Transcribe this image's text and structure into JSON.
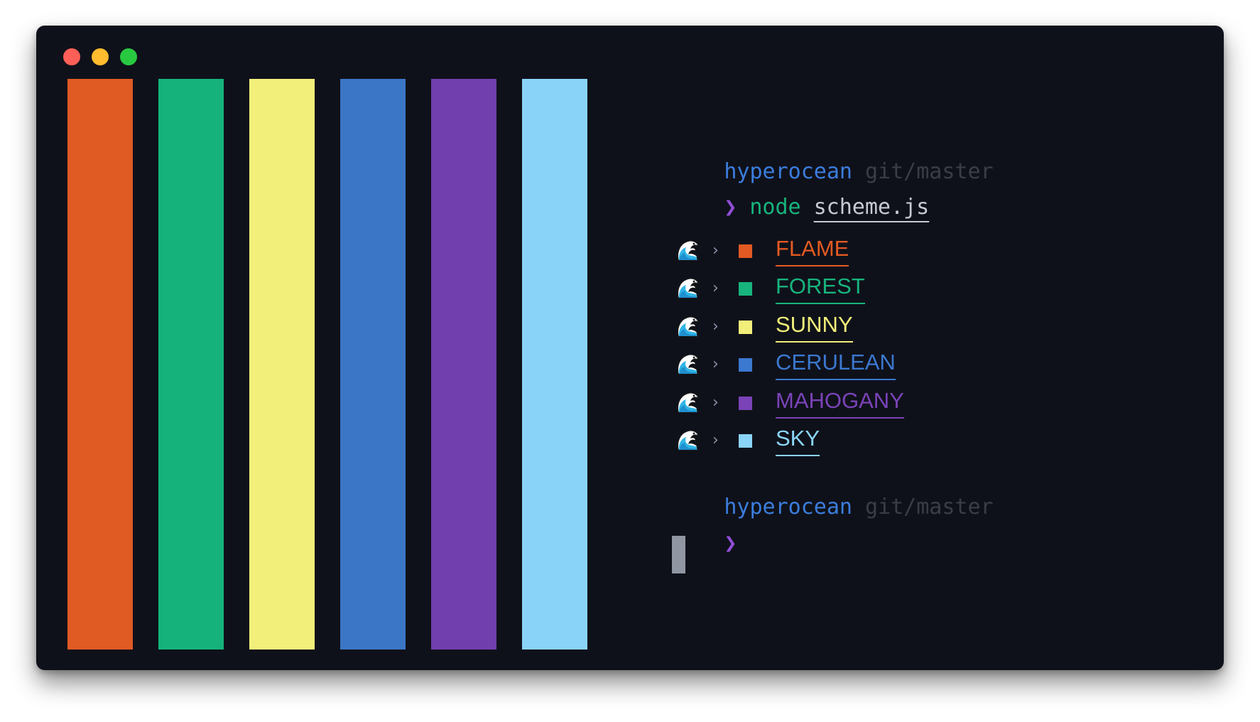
{
  "window": {
    "traffic_lights": [
      {
        "name": "close",
        "color": "#ff5f57"
      },
      {
        "name": "minimize",
        "color": "#febc2e"
      },
      {
        "name": "maximize",
        "color": "#28c840"
      }
    ],
    "background": "#0f111a"
  },
  "palette_bars": [
    {
      "name": "FLAME",
      "color": "#e05a24"
    },
    {
      "name": "FOREST",
      "color": "#15b37b"
    },
    {
      "name": "SUNNY",
      "color": "#f2f07b"
    },
    {
      "name": "CERULEAN",
      "color": "#3b76c6"
    },
    {
      "name": "MAHOGANY",
      "color": "#713fae"
    },
    {
      "name": "SKY",
      "color": "#8ad3f8"
    }
  ],
  "terminal": {
    "prompt1": {
      "user": "hyperocean",
      "branch": "git/master",
      "chevron": "❯",
      "command": "node",
      "argument": "scheme.js"
    },
    "output": [
      {
        "icon": "water-wave-icon",
        "arrow": "›",
        "label": "FLAME",
        "color": "#e35a22"
      },
      {
        "icon": "water-wave-icon",
        "arrow": "›",
        "label": "FOREST",
        "color": "#17b47d"
      },
      {
        "icon": "water-wave-icon",
        "arrow": "›",
        "label": "SUNNY",
        "color": "#f2ee7a"
      },
      {
        "icon": "water-wave-icon",
        "arrow": "›",
        "label": "CERULEAN",
        "color": "#3b78d0"
      },
      {
        "icon": "water-wave-icon",
        "arrow": "›",
        "label": "MAHOGANY",
        "color": "#7a43b8"
      },
      {
        "icon": "water-wave-icon",
        "arrow": "›",
        "label": "SKY",
        "color": "#8ad4f7"
      }
    ],
    "prompt2": {
      "user": "hyperocean",
      "branch": "git/master",
      "chevron": "❯",
      "input": ""
    }
  }
}
